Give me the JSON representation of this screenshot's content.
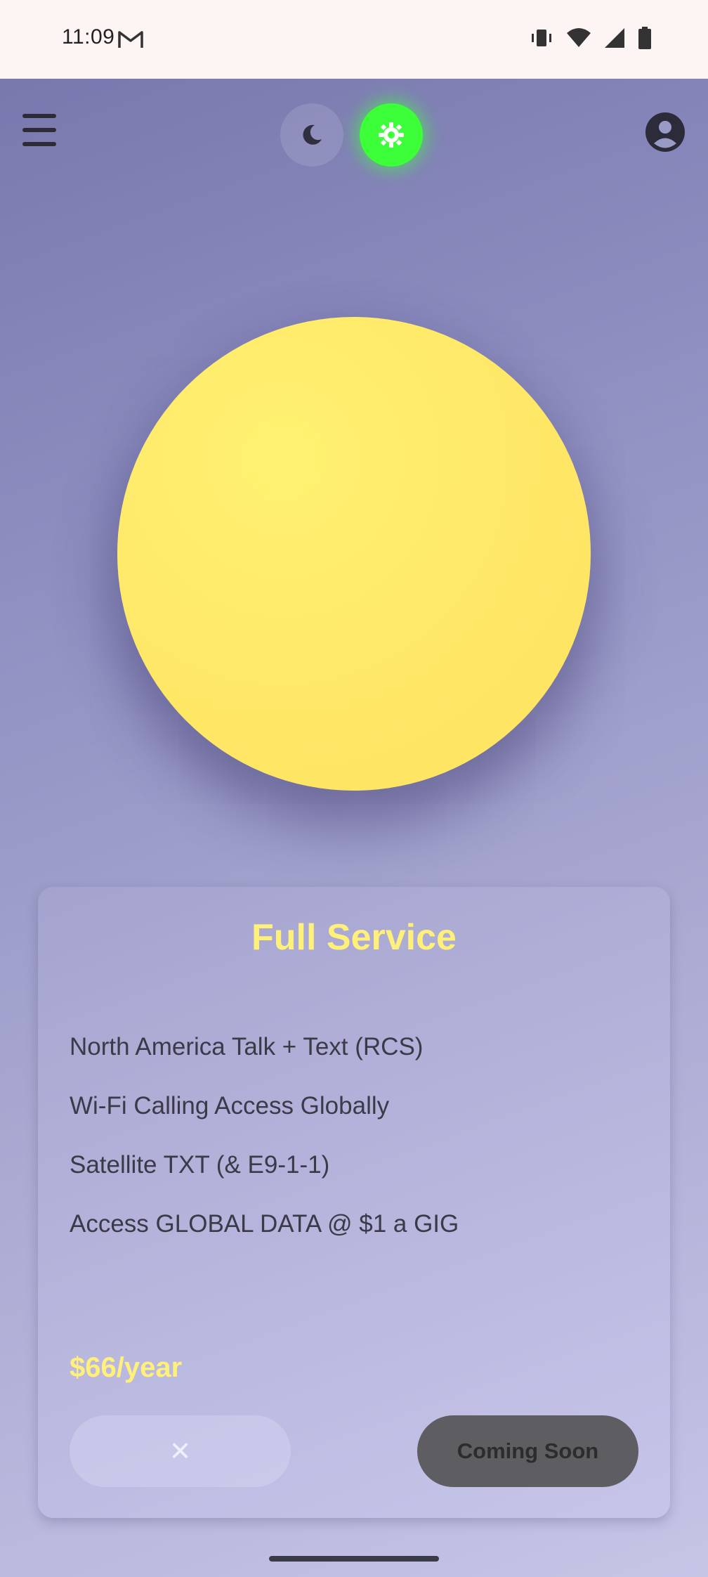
{
  "status_bar": {
    "time": "11:09",
    "icons": [
      "gmail-icon",
      "vibrate-icon",
      "wifi-icon",
      "cellular-signal-icon",
      "battery-icon"
    ]
  },
  "header": {
    "menu_icon": "hamburger-menu-icon",
    "theme_toggle": {
      "dark_icon": "moon-icon",
      "light_icon": "sun-icon",
      "active": "light",
      "active_color": "#3cff3a"
    },
    "account_icon": "account-circle-icon"
  },
  "hero": {
    "color": "#ffe96a"
  },
  "plan_card": {
    "title": "Full Service",
    "features": [
      "North America Talk + Text (RCS)",
      "Wi-Fi Calling Access Globally",
      "Satellite TXT (& E9-1-1)",
      "Access GLOBAL DATA @ $1 a GIG"
    ],
    "price": "$66/year",
    "close_label": "✕",
    "action_label": "Coming Soon",
    "accent_color": "#fff07a"
  }
}
